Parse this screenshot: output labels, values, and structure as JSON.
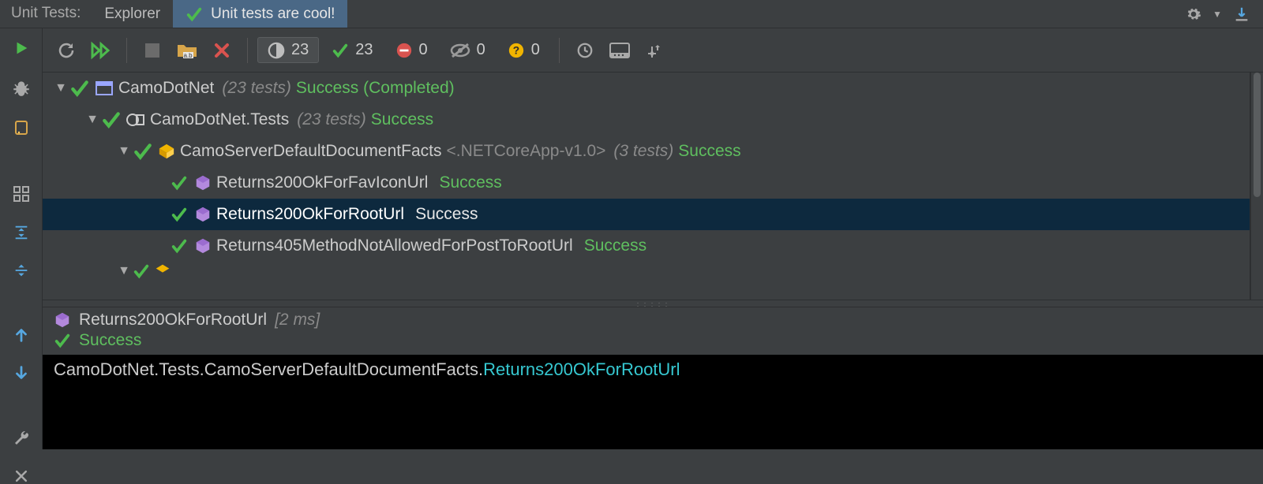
{
  "header": {
    "prefix": "Unit Tests:",
    "tabs": [
      {
        "label": "Explorer",
        "active": false
      },
      {
        "label": "Unit tests are cool!",
        "active": true
      }
    ]
  },
  "toolbar": {
    "counters": {
      "total": "23",
      "passed": "23",
      "failed": "0",
      "ignored": "0",
      "inconclusive": "0"
    }
  },
  "tree": [
    {
      "depth": 0,
      "expander": "▼",
      "icon": "project",
      "name": "CamoDotNet",
      "count": "(23 tests)",
      "status": "Success (Completed)",
      "selected": false
    },
    {
      "depth": 1,
      "expander": "▼",
      "icon": "module",
      "name": "CamoDotNet.Tests",
      "count": "(23 tests)",
      "status": "Success",
      "selected": false
    },
    {
      "depth": 2,
      "expander": "▼",
      "icon": "class",
      "name": "CamoServerDefaultDocumentFacts",
      "framework": "<.NETCoreApp-v1.0>",
      "count": "(3 tests)",
      "status": "Success",
      "selected": false
    },
    {
      "depth": 3,
      "expander": "",
      "icon": "test",
      "name": "Returns200OkForFavIconUrl",
      "status": "Success",
      "selected": false
    },
    {
      "depth": 3,
      "expander": "",
      "icon": "test",
      "name": "Returns200OkForRootUrl",
      "status": "Success",
      "selected": true
    },
    {
      "depth": 3,
      "expander": "",
      "icon": "test",
      "name": "Returns405MethodNotAllowedForPostToRootUrl",
      "status": "Success",
      "selected": false
    }
  ],
  "detail": {
    "name": "Returns200OkForRootUrl",
    "duration": "[2 ms]",
    "status": "Success",
    "output_prefix": "CamoDotNet.Tests.CamoServerDefaultDocumentFacts.",
    "output_method": "Returns200OkForRootUrl"
  }
}
